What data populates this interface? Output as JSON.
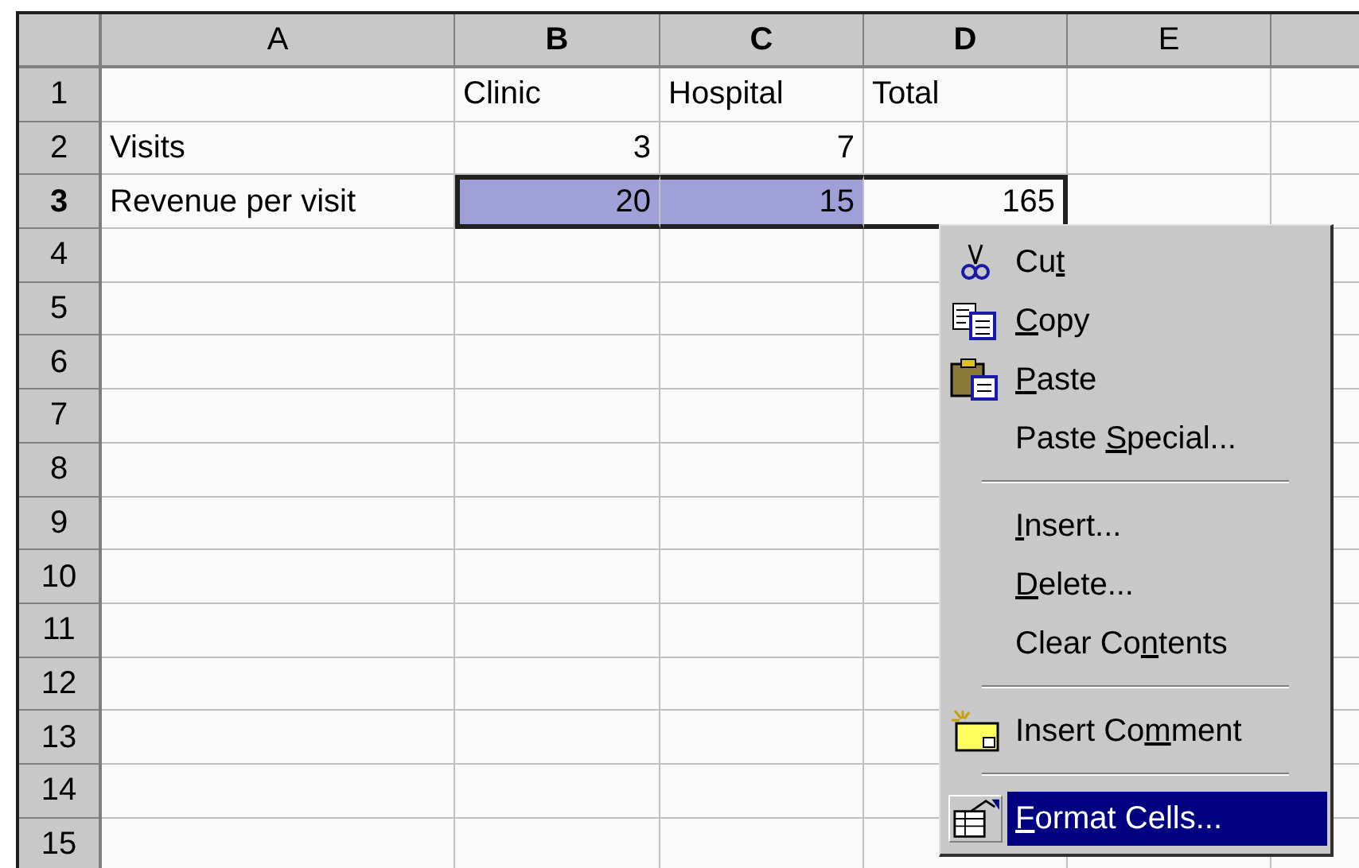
{
  "columns": [
    {
      "label": "A",
      "selected": false
    },
    {
      "label": "B",
      "selected": true
    },
    {
      "label": "C",
      "selected": true
    },
    {
      "label": "D",
      "selected": true
    },
    {
      "label": "E",
      "selected": false
    }
  ],
  "rows": [
    {
      "header": "1",
      "selected": false,
      "cells": [
        {},
        {
          "text": "Clinic",
          "kind": "text"
        },
        {
          "text": "Hospital",
          "kind": "text"
        },
        {
          "text": "Total",
          "kind": "text"
        },
        {}
      ]
    },
    {
      "header": "2",
      "selected": false,
      "cells": [
        {
          "text": "Visits",
          "kind": "text"
        },
        {
          "text": "3",
          "kind": "number"
        },
        {
          "text": "7",
          "kind": "number"
        },
        {},
        {}
      ]
    },
    {
      "header": "3",
      "selected": true,
      "cells": [
        {
          "text": "Revenue per visit",
          "kind": "text"
        },
        {
          "text": "20",
          "kind": "number",
          "in_range": true,
          "highlighted": true
        },
        {
          "text": "15",
          "kind": "number",
          "in_range": true,
          "highlighted": true
        },
        {
          "text": "165",
          "kind": "number",
          "in_range": true,
          "highlighted": false
        },
        {}
      ]
    },
    {
      "header": "4",
      "selected": false,
      "cells": [
        {},
        {},
        {},
        {},
        {}
      ]
    },
    {
      "header": "5",
      "selected": false,
      "cells": [
        {},
        {},
        {},
        {},
        {}
      ]
    },
    {
      "header": "6",
      "selected": false,
      "cells": [
        {},
        {},
        {},
        {},
        {}
      ]
    },
    {
      "header": "7",
      "selected": false,
      "cells": [
        {},
        {},
        {},
        {},
        {}
      ]
    },
    {
      "header": "8",
      "selected": false,
      "cells": [
        {},
        {},
        {},
        {},
        {}
      ]
    },
    {
      "header": "9",
      "selected": false,
      "cells": [
        {},
        {},
        {},
        {},
        {}
      ]
    },
    {
      "header": "10",
      "selected": false,
      "cells": [
        {},
        {},
        {},
        {},
        {}
      ]
    },
    {
      "header": "11",
      "selected": false,
      "cells": [
        {},
        {},
        {},
        {},
        {}
      ]
    },
    {
      "header": "12",
      "selected": false,
      "cells": [
        {},
        {},
        {},
        {},
        {}
      ]
    },
    {
      "header": "13",
      "selected": false,
      "cells": [
        {},
        {},
        {},
        {},
        {}
      ]
    },
    {
      "header": "14",
      "selected": false,
      "cells": [
        {},
        {},
        {},
        {},
        {}
      ]
    },
    {
      "header": "15",
      "selected": false,
      "cells": [
        {},
        {},
        {},
        {},
        {}
      ]
    }
  ],
  "context_menu": [
    {
      "kind": "item",
      "before": "Cu",
      "key": "t",
      "selected": false
    },
    {
      "kind": "item",
      "key": "C",
      "after": "opy",
      "selected": false
    },
    {
      "kind": "item",
      "key": "P",
      "after": "aste",
      "selected": false
    },
    {
      "kind": "item",
      "before": "Paste ",
      "key": "S",
      "after": "pecial...",
      "selected": false
    },
    {
      "kind": "separator"
    },
    {
      "kind": "item",
      "key": "I",
      "after": "nsert...",
      "selected": false
    },
    {
      "kind": "item",
      "key": "D",
      "after": "elete...",
      "selected": false
    },
    {
      "kind": "item",
      "before": "Clear Co",
      "key": "n",
      "after": "tents",
      "selected": false
    },
    {
      "kind": "separator"
    },
    {
      "kind": "item",
      "before": "Insert Co",
      "key": "m",
      "after": "ment",
      "selected": false
    },
    {
      "kind": "separator"
    },
    {
      "kind": "item",
      "key": "F",
      "after": "ormat Cells...",
      "selected": true
    }
  ]
}
